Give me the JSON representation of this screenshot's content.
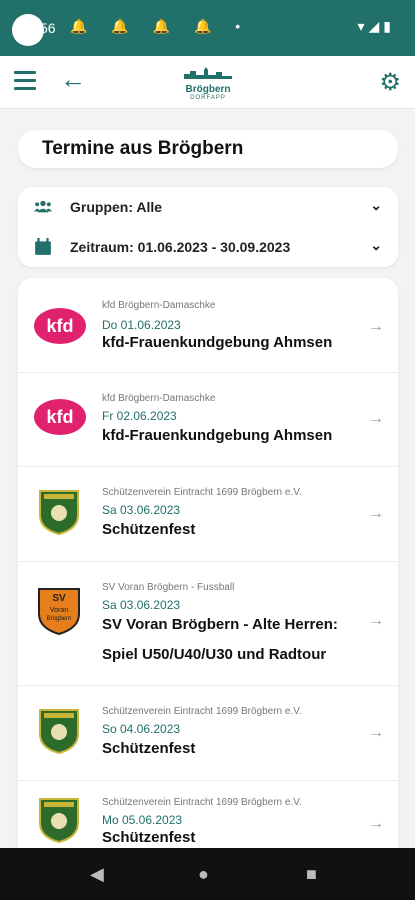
{
  "status_bar": {
    "time": "56",
    "notification_icons": "🔔 🔔 🔔 🔔 •",
    "right_icons": "▾◢▮"
  },
  "app_bar": {
    "logo_name": "Brögbern",
    "logo_sub": "DORFAPP"
  },
  "page": {
    "title": "Termine aus Brögbern"
  },
  "filters": {
    "groups": "Gruppen: Alle",
    "period": "Zeitraum: 01.06.2023 - 30.09.2023"
  },
  "events": [
    {
      "logo": "kfd",
      "org": "kfd Brögbern-Damaschke",
      "date": "Do 01.06.2023",
      "title": "kfd-Frauenkundgebung Ahmsen"
    },
    {
      "logo": "kfd",
      "org": "kfd Brögbern-Damaschke",
      "date": "Fr 02.06.2023",
      "title": "kfd-Frauenkundgebung Ahmsen"
    },
    {
      "logo": "shield",
      "org": "Schützenverein Eintracht 1699 Brögbern e.V.",
      "date": "Sa 03.06.2023",
      "title": "Schützenfest"
    },
    {
      "logo": "sv",
      "org": "SV Voran Brögbern - Fussball",
      "date": "Sa 03.06.2023",
      "title": "SV Voran Brögbern - Alte Herren: Spiel U50/U40/U30 und Radtour"
    },
    {
      "logo": "shield",
      "org": "Schützenverein Eintracht 1699 Brögbern e.V.",
      "date": "So 04.06.2023",
      "title": "Schützenfest"
    },
    {
      "logo": "shield",
      "org": "Schützenverein Eintracht 1699 Brögbern e.V.",
      "date": "Mo 05.06.2023",
      "title": "Schützenfest"
    }
  ],
  "sv_logo_text": {
    "top": "SV",
    "line1": "Voran",
    "line2": "Brögbern"
  },
  "colors": {
    "primary": "#21706a",
    "kfd": "#e0226e"
  }
}
